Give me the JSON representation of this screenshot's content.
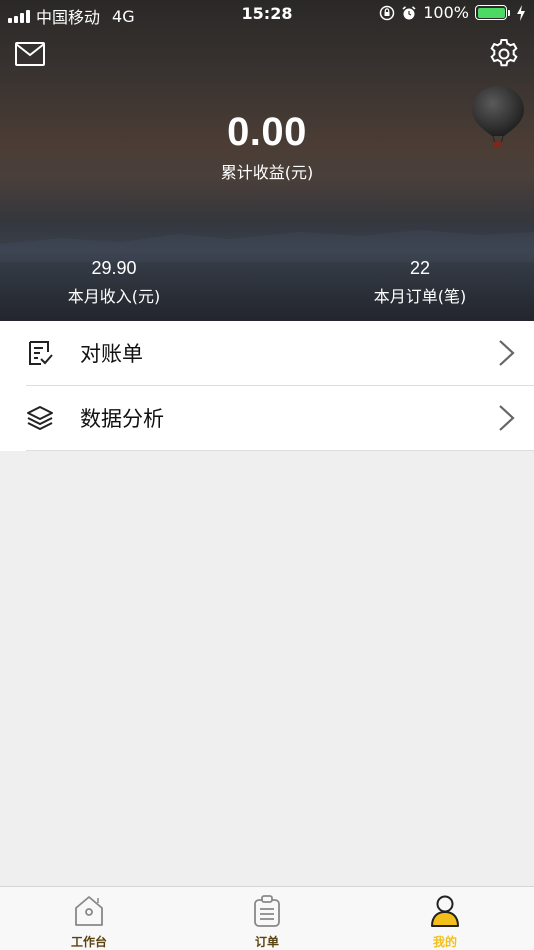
{
  "status_bar": {
    "carrier": "中国移动",
    "network": "4G",
    "time": "15:28",
    "battery": "100%"
  },
  "header": {
    "total_value": "0.00",
    "total_label": "累计收益(元)",
    "stats": [
      {
        "value": "29.90",
        "label": "本月收入(元)"
      },
      {
        "value": "22",
        "label": "本月订单(笔)"
      }
    ],
    "icons": {
      "left": "mail-icon",
      "right": "gear-icon"
    }
  },
  "menu": {
    "items": [
      {
        "label": "对账单",
        "icon": "statement-icon"
      },
      {
        "label": "数据分析",
        "icon": "layers-icon"
      }
    ]
  },
  "tabbar": {
    "tabs": [
      {
        "label": "工作台",
        "icon": "home-icon"
      },
      {
        "label": "订单",
        "icon": "clipboard-icon"
      },
      {
        "label": "我的",
        "icon": "user-icon",
        "active": true
      }
    ],
    "active_color": "#f3bf1c",
    "inactive_color": "#5a4310"
  }
}
